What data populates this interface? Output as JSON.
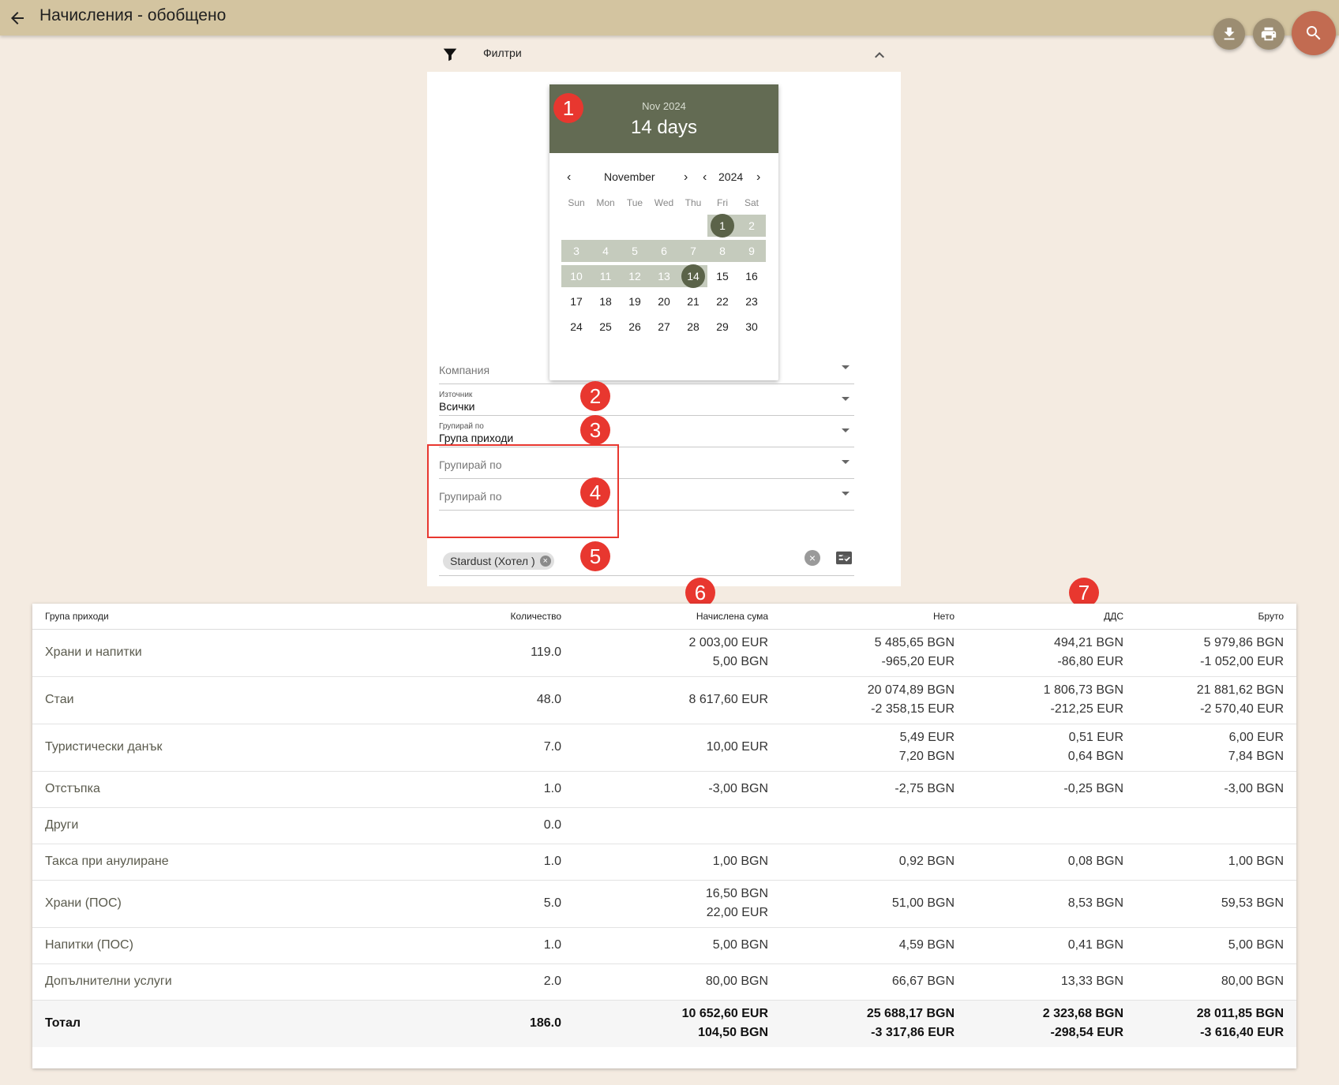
{
  "header": {
    "title": "Начисления - обобщено"
  },
  "filters": {
    "title": "Филтри",
    "datepicker": {
      "month_year": "Nov 2024",
      "range_label": "14 days",
      "month": "November",
      "year": "2024",
      "weekdays": [
        "Sun",
        "Mon",
        "Tue",
        "Wed",
        "Thu",
        "Fri",
        "Sat"
      ],
      "days": [
        "1",
        "2",
        "3",
        "4",
        "5",
        "6",
        "7",
        "8",
        "9",
        "10",
        "11",
        "12",
        "13",
        "14",
        "15",
        "16",
        "17",
        "18",
        "19",
        "20",
        "21",
        "22",
        "23",
        "24",
        "25",
        "26",
        "27",
        "28",
        "29",
        "30"
      ],
      "range_start": 1,
      "range_end": 14
    },
    "company": {
      "placeholder": "Компания"
    },
    "source": {
      "label": "Източник",
      "value": "Всички"
    },
    "group1": {
      "label": "Групирай по",
      "value": "Група приходи"
    },
    "group2": {
      "placeholder": "Групирай по"
    },
    "group3": {
      "placeholder": "Групирай по"
    },
    "property_chip": "Stardust (Хотел )"
  },
  "markers": [
    "1",
    "2",
    "3",
    "4",
    "5",
    "6",
    "7"
  ],
  "table": {
    "headers": {
      "group": "Група приходи",
      "qty": "Количество",
      "charged": "Начислена сума",
      "net": "Нето",
      "vat": "ДДС",
      "gross": "Бруто"
    },
    "rows": [
      {
        "name": "Храни и напитки",
        "qty": "119.0",
        "charged": [
          "2 003,00 EUR",
          "5,00 BGN"
        ],
        "net": [
          "5 485,65 BGN",
          "-965,20 EUR"
        ],
        "vat": [
          "494,21 BGN",
          "-86,80 EUR"
        ],
        "gross": [
          "5 979,86 BGN",
          "-1 052,00 EUR"
        ]
      },
      {
        "name": "Стаи",
        "qty": "48.0",
        "charged": [
          "8 617,60 EUR"
        ],
        "net": [
          "20 074,89 BGN",
          "-2 358,15 EUR"
        ],
        "vat": [
          "1 806,73 BGN",
          "-212,25 EUR"
        ],
        "gross": [
          "21 881,62 BGN",
          "-2 570,40 EUR"
        ]
      },
      {
        "name": "Туристически данък",
        "qty": "7.0",
        "charged": [
          "10,00 EUR"
        ],
        "net": [
          "5,49 EUR",
          "7,20 BGN"
        ],
        "vat": [
          "0,51 EUR",
          "0,64 BGN"
        ],
        "gross": [
          "6,00 EUR",
          "7,84 BGN"
        ]
      },
      {
        "name": "Отстъпка",
        "qty": "1.0",
        "charged": [
          "-3,00 BGN"
        ],
        "net": [
          "-2,75 BGN"
        ],
        "vat": [
          "-0,25 BGN"
        ],
        "gross": [
          "-3,00 BGN"
        ]
      },
      {
        "name": "Други",
        "qty": "0.0",
        "charged": [],
        "net": [],
        "vat": [],
        "gross": []
      },
      {
        "name": "Такса при анулиране",
        "qty": "1.0",
        "charged": [
          "1,00 BGN"
        ],
        "net": [
          "0,92 BGN"
        ],
        "vat": [
          "0,08 BGN"
        ],
        "gross": [
          "1,00 BGN"
        ]
      },
      {
        "name": "Храни (ПОС)",
        "qty": "5.0",
        "charged": [
          "16,50 BGN",
          "22,00 EUR"
        ],
        "net": [
          "51,00 BGN"
        ],
        "vat": [
          "8,53 BGN"
        ],
        "gross": [
          "59,53 BGN"
        ]
      },
      {
        "name": "Напитки (ПОС)",
        "qty": "1.0",
        "charged": [
          "5,00 BGN"
        ],
        "net": [
          "4,59 BGN"
        ],
        "vat": [
          "0,41 BGN"
        ],
        "gross": [
          "5,00 BGN"
        ]
      },
      {
        "name": "Допълнителни услуги",
        "qty": "2.0",
        "charged": [
          "80,00 BGN"
        ],
        "net": [
          "66,67 BGN"
        ],
        "vat": [
          "13,33 BGN"
        ],
        "gross": [
          "80,00 BGN"
        ]
      }
    ],
    "total": {
      "name": "Тотал",
      "qty": "186.0",
      "charged": [
        "10 652,60 EUR",
        "104,50 BGN"
      ],
      "net": [
        "25 688,17 BGN",
        "-3 317,86 EUR"
      ],
      "vat": [
        "2 323,68 BGN",
        "-298,54 EUR"
      ],
      "gross": [
        "28 011,85 BGN",
        "-3 616,40 EUR"
      ]
    }
  },
  "colors": {
    "topbar": "#d3c4a0",
    "background": "#f4ebe1",
    "datepicker_header": "#636b53",
    "range_fill": "#c5cbbd",
    "search_fab": "#c26b51",
    "marker": "#e8372f"
  }
}
